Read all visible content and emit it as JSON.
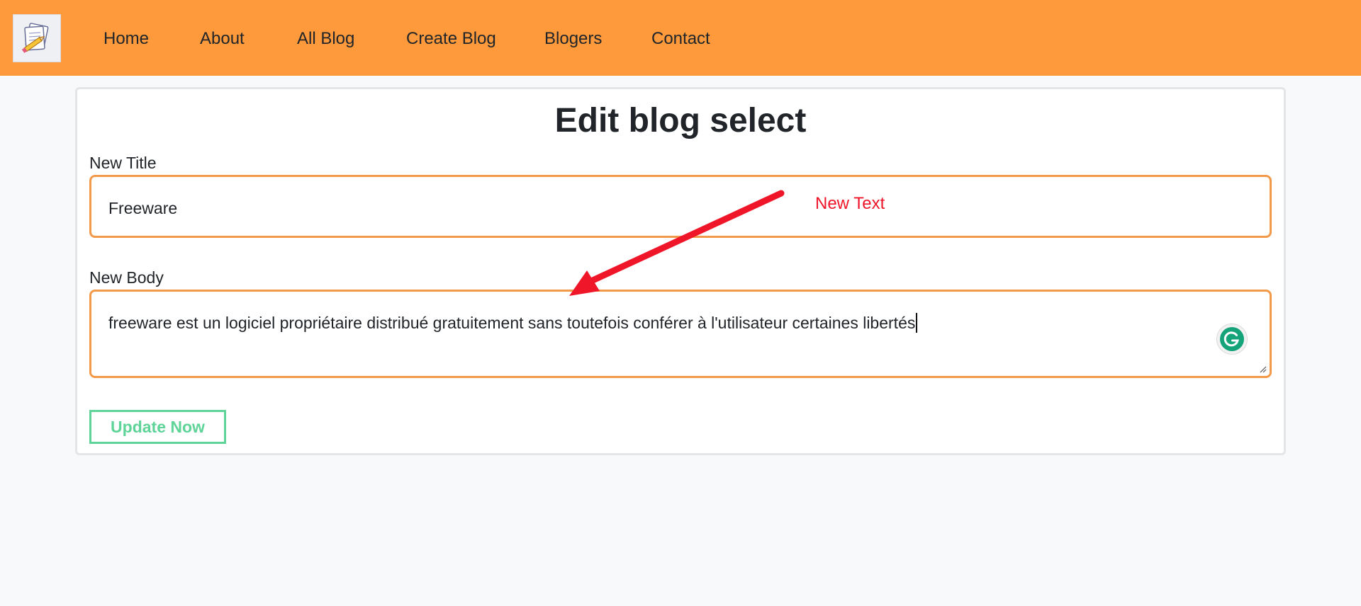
{
  "nav": {
    "items": [
      {
        "label": "Home"
      },
      {
        "label": "About"
      },
      {
        "label": "All Blog"
      },
      {
        "label": "Create Blog"
      },
      {
        "label": "Blogers"
      },
      {
        "label": "Contact"
      }
    ]
  },
  "form": {
    "heading": "Edit blog select",
    "title_label": "New Title",
    "title_value": "Freeware",
    "body_label": "New Body",
    "body_value": "freeware est un logiciel propriétaire distribué gratuitement sans toutefois conférer à l'utilisateur certaines libertés",
    "submit_label": "Update Now"
  },
  "annotation": {
    "text": "New Text",
    "color": "#f0162a"
  },
  "colors": {
    "navbar": "#fe9a3c",
    "field_border": "#f39a4a",
    "button_accent": "#5fd498",
    "grammarly": "#15a37a"
  }
}
